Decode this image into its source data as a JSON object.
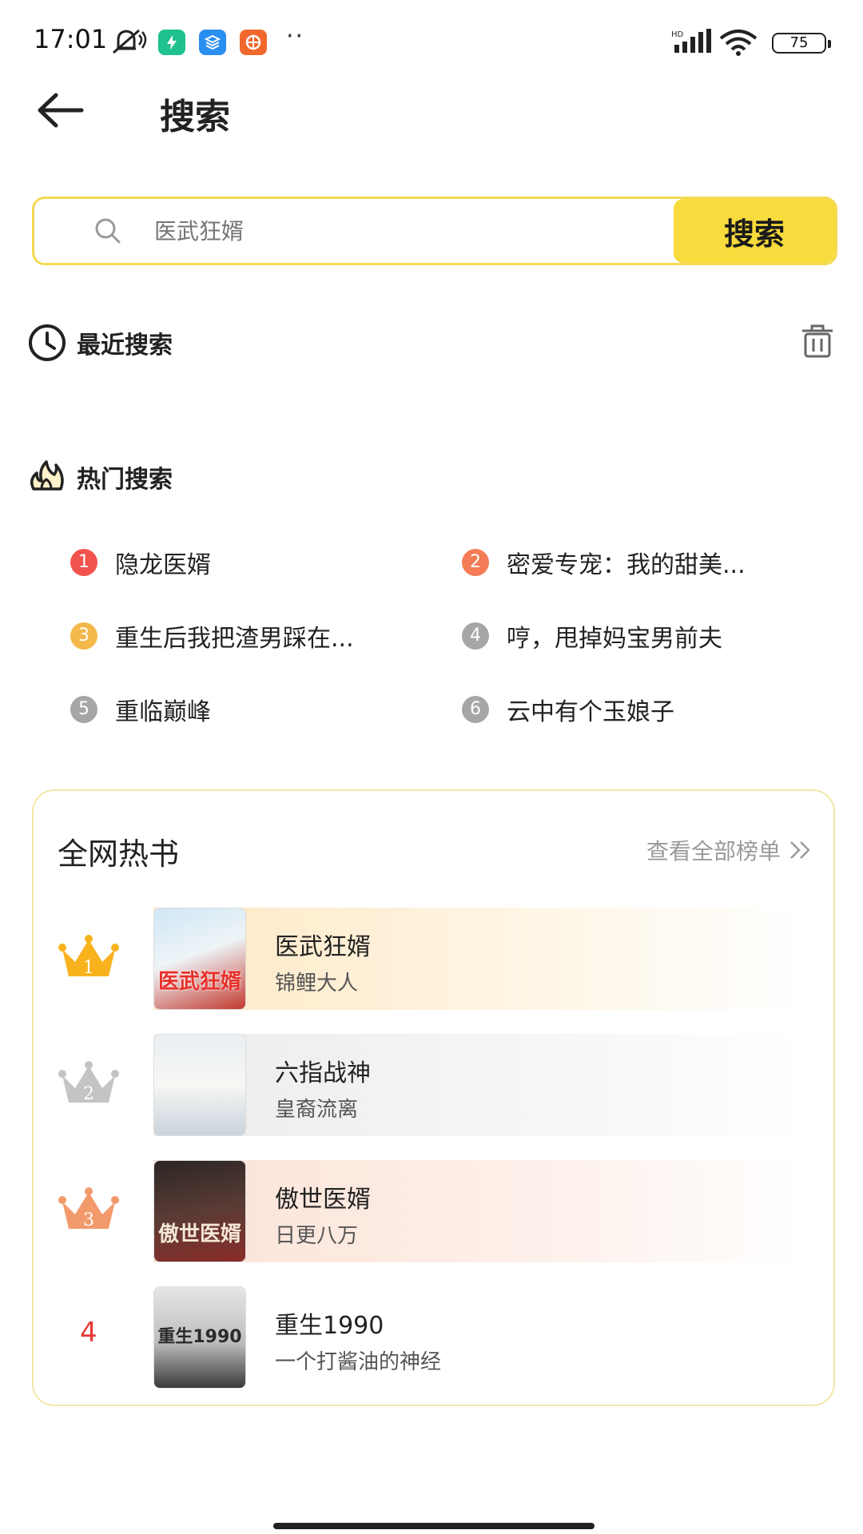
{
  "status_bar": {
    "time": "17:01",
    "more": "··",
    "battery": "75"
  },
  "header": {
    "title": "搜索"
  },
  "search": {
    "placeholder": "医武狂婿",
    "button_label": "搜索"
  },
  "recent": {
    "title": "最近搜索"
  },
  "hot": {
    "title": "热门搜索",
    "items": [
      {
        "rank": "1",
        "text": "隐龙医婿",
        "color": "#f1534f"
      },
      {
        "rank": "2",
        "text": "密爱专宠：我的甜美...",
        "color": "#f47c57"
      },
      {
        "rank": "3",
        "text": "重生后我把渣男踩在...",
        "color": "#f5b84b"
      },
      {
        "rank": "4",
        "text": "哼，甩掉妈宝男前夫",
        "color": "#a6a6a6"
      },
      {
        "rank": "5",
        "text": "重临巅峰",
        "color": "#a6a6a6"
      },
      {
        "rank": "6",
        "text": "云中有个玉娘子",
        "color": "#a6a6a6"
      }
    ]
  },
  "ranking": {
    "title": "全网热书",
    "view_all": "查看全部榜单",
    "books": [
      {
        "rank": "1",
        "title": "医武狂婿",
        "author": "锦鲤大人",
        "cover_text": "医武狂婿",
        "row_color": "#fde8c4",
        "badge_color": "#f7b21e"
      },
      {
        "rank": "2",
        "title": "六指战神",
        "author": "皇裔流离",
        "cover_text": "",
        "row_color": "#ececec",
        "badge_color": "#bdbdbd"
      },
      {
        "rank": "3",
        "title": "傲世医婿",
        "author": "日更八万",
        "cover_text": "傲世医婿",
        "row_color": "#fbe3d6",
        "badge_color": "#f29a6c"
      },
      {
        "rank": "4",
        "title": "重生1990",
        "author": "一个打酱油的神经",
        "cover_text": "重生1990",
        "row_color": "#ffffff",
        "badge_color": "#e53935"
      }
    ]
  }
}
